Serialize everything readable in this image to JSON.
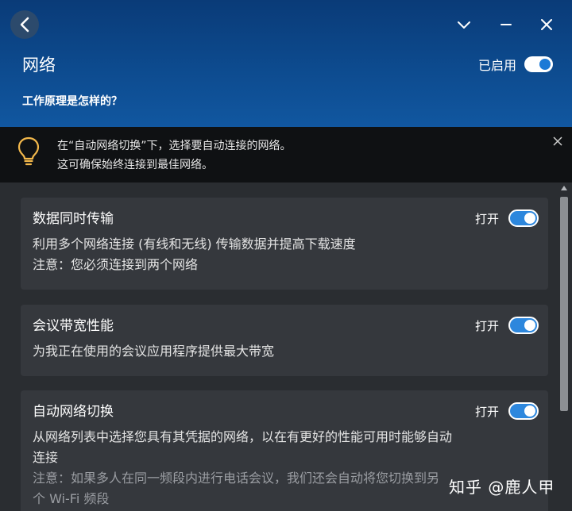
{
  "header": {
    "title": "网络",
    "how_it_works": "工作原理是怎样的？",
    "enabled_label": "已启用"
  },
  "banner": {
    "line1": "在“自动网络切换”下，选择要自动连接的网络。",
    "line2": "这可确保始终连接到最佳网络。"
  },
  "cards": [
    {
      "title": "数据同时传输",
      "toggle_label": "打开",
      "desc1": "利用多个网络连接 (有线和无线) 传输数据并提高下载速度",
      "desc2": "注意：您必须连接到两个网络"
    },
    {
      "title": "会议带宽性能",
      "toggle_label": "打开",
      "desc1": "为我正在使用的会议应用程序提供最大带宽"
    },
    {
      "title": "自动网络切换",
      "toggle_label": "打开",
      "desc1": "从网络列表中选择您具有其凭据的网络，以在有更好的性能可用时能够自动",
      "desc2": "连接",
      "desc3": "注意：如果多人在同一频段内进行电话会议，我们还会自动将您切换到另",
      "desc4": "个 Wi-Fi 频段"
    }
  ],
  "watermark": "知乎 @鹿人甲",
  "colors": {
    "header_top": "#0a3b78",
    "header_bottom": "#1157a0",
    "accent": "#2d87dd",
    "banner_bg": "#0f1113",
    "card_bg": "#35383d",
    "content_bg": "#2a2d31",
    "bulb": "#f2b84b"
  },
  "icons": [
    "back-arrow-icon",
    "chevron-down-icon",
    "minimize-icon",
    "close-icon",
    "lightbulb-icon",
    "banner-close-icon",
    "scroll-up-icon"
  ]
}
